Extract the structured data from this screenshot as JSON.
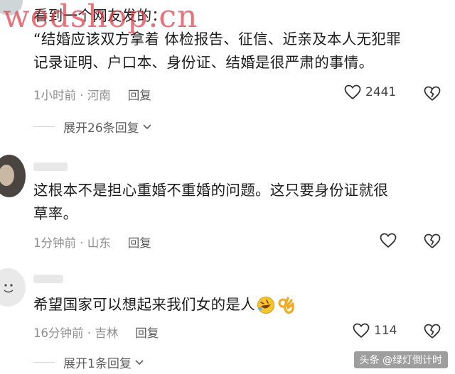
{
  "watermark": "wedshop.cn",
  "comments": [
    {
      "text_lines": [
        "看到一个网友发的：",
        "“结婚应该双方拿着 体检报告、征信、近亲及本人无犯罪",
        "记录证明、户口本、身份证、结婚是很严肃的事情。"
      ],
      "meta": "1小时前 · 河南",
      "reply_label": "回复",
      "likes": "2441",
      "expand_label": "展开26条回复"
    },
    {
      "text_lines": [
        "这根本不是担心重婚不重婚的问题。这只要身份证就很",
        "草率。"
      ],
      "meta": "1分钟前 · 山东",
      "reply_label": "回复",
      "likes": ""
    },
    {
      "text_lines": [
        "希望国家可以想起来我们女的是人"
      ],
      "emoji": [
        "rofl-emoji",
        "ok-hand-emoji"
      ],
      "meta": "16分钟前 · 吉林",
      "reply_label": "回复",
      "likes": "114",
      "expand_label": "展开1条回复"
    }
  ],
  "footer": "头条 @绿灯倒计时",
  "colors": {
    "watermark": "#dc3c46",
    "text": "#1c1c1c",
    "meta": "#8e8e8e"
  }
}
